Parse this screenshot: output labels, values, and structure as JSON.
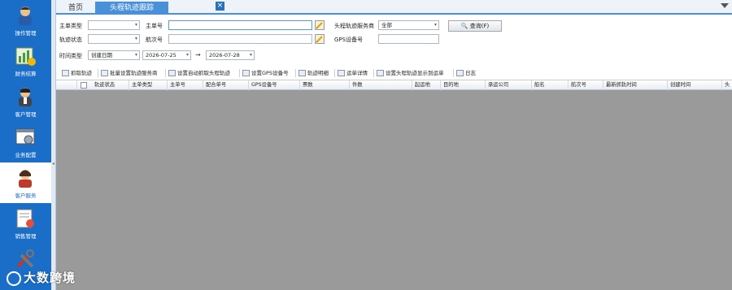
{
  "sidebar": {
    "items": [
      {
        "label": "操作管理"
      },
      {
        "label": "财务结算"
      },
      {
        "label": "客户管理"
      },
      {
        "label": "业务配置"
      },
      {
        "label": "客户服务"
      },
      {
        "label": "销售管理"
      }
    ]
  },
  "tabs": [
    {
      "label": "首页"
    },
    {
      "label": "头程轨迹跟踪"
    }
  ],
  "filter": {
    "master_type_label": "主单类型",
    "master_no_label": "主单号",
    "provider_label": "头程轨迹服务商",
    "provider_value": "全部",
    "query_label": "查询(F)",
    "track_status_label": "轨迹状态",
    "flight_no_label": "航次号",
    "gps_label": "GPS设备号",
    "time_type_label": "时间类型",
    "time_type_value": "创建日期",
    "date_from": "2026-07-25",
    "date_to": "2026-07-28",
    "arrow": "→"
  },
  "toolbar": [
    {
      "label": "抓取轨迹"
    },
    {
      "label": "批量设置轨迹服务商"
    },
    {
      "label": "设置自动抓取头程轨迹"
    },
    {
      "label": "设置GPS设备号"
    },
    {
      "label": "轨迹明细"
    },
    {
      "label": "运单详情"
    },
    {
      "label": "设置头程轨迹显示到运单"
    },
    {
      "label": "日志"
    }
  ],
  "grid": {
    "columns": [
      "轨迹状态",
      "主单类型",
      "主单号",
      "配合单号",
      "GPS设备号",
      "票数",
      "件数",
      "起运地",
      "目的地",
      "承运公司",
      "船名",
      "航次号",
      "最新抓轨时间",
      "创建时间",
      "头"
    ]
  },
  "watermark": "大数跨境",
  "colors": {
    "sidebar": "#1a6ec8",
    "tab_active": "#4a90d9",
    "grid_body": "#9a9a9a"
  }
}
